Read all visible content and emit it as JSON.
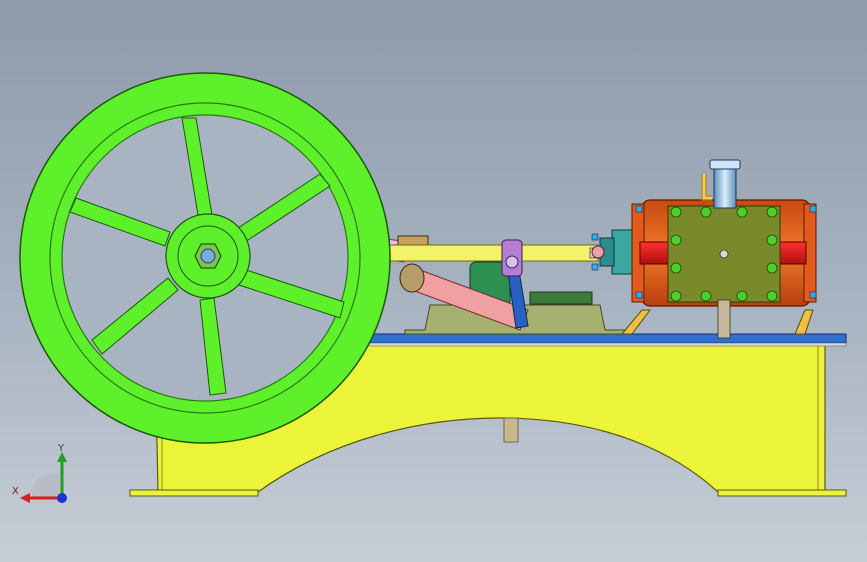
{
  "viewport": {
    "background_top": "#8e9aaa",
    "background_bottom": "#c6cdd6"
  },
  "model": {
    "parts": [
      {
        "name": "base-frame",
        "color": "#ecf43a"
      },
      {
        "name": "base-plate",
        "color": "#2f6fd0"
      },
      {
        "name": "flywheel",
        "color": "#5ef02a"
      },
      {
        "name": "crank-disc",
        "color": "#e63c4c"
      },
      {
        "name": "bearing-pedestal",
        "color": "#1fa46a"
      },
      {
        "name": "connecting-rod",
        "color": "#f0b8e8"
      },
      {
        "name": "eccentric-rod",
        "color": "#8a2be2"
      },
      {
        "name": "piston-rod",
        "color": "#f4f26a"
      },
      {
        "name": "steam-cylinder",
        "color": "#e8641e"
      },
      {
        "name": "valve-chest",
        "color": "#7a8a2a"
      },
      {
        "name": "steam-inlet-pipe",
        "color": "#8fc0e8"
      },
      {
        "name": "oscillating-link",
        "color": "#f0a0a0"
      }
    ]
  },
  "triad": {
    "x_label": "X",
    "y_label": "Y",
    "x_color": "#d42020",
    "y_color": "#20a020",
    "z_color": "#2030d0"
  }
}
